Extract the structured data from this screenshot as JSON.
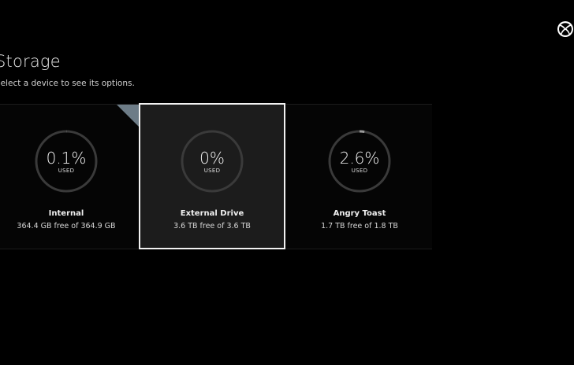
{
  "header": {
    "title": "Storage",
    "subtitle": "Select a device to see its options."
  },
  "colors": {
    "background": "#000000",
    "tile_selected_bg": "#1c1c1c",
    "ring_track": "#3a3a3a",
    "ring_fill": "#9a9a9a",
    "selection_border": "#f2f2f2",
    "corner_flag": "#6d7c87"
  },
  "logo_icon": "xbox-logo-icon",
  "devices": [
    {
      "name": "Internal",
      "percent_label": "0.1%",
      "used_label": "USED",
      "free_text": "364.4 GB free of 364.9 GB",
      "used_fraction": 0.001,
      "selected": false
    },
    {
      "name": "External Drive",
      "percent_label": "0%",
      "used_label": "USED",
      "free_text": "3.6 TB free of 3.6 TB",
      "used_fraction": 0.0,
      "selected": true
    },
    {
      "name": "Angry Toast",
      "percent_label": "2.6%",
      "used_label": "USED",
      "free_text": "1.7 TB free of 1.8 TB",
      "used_fraction": 0.026,
      "selected": false
    }
  ]
}
